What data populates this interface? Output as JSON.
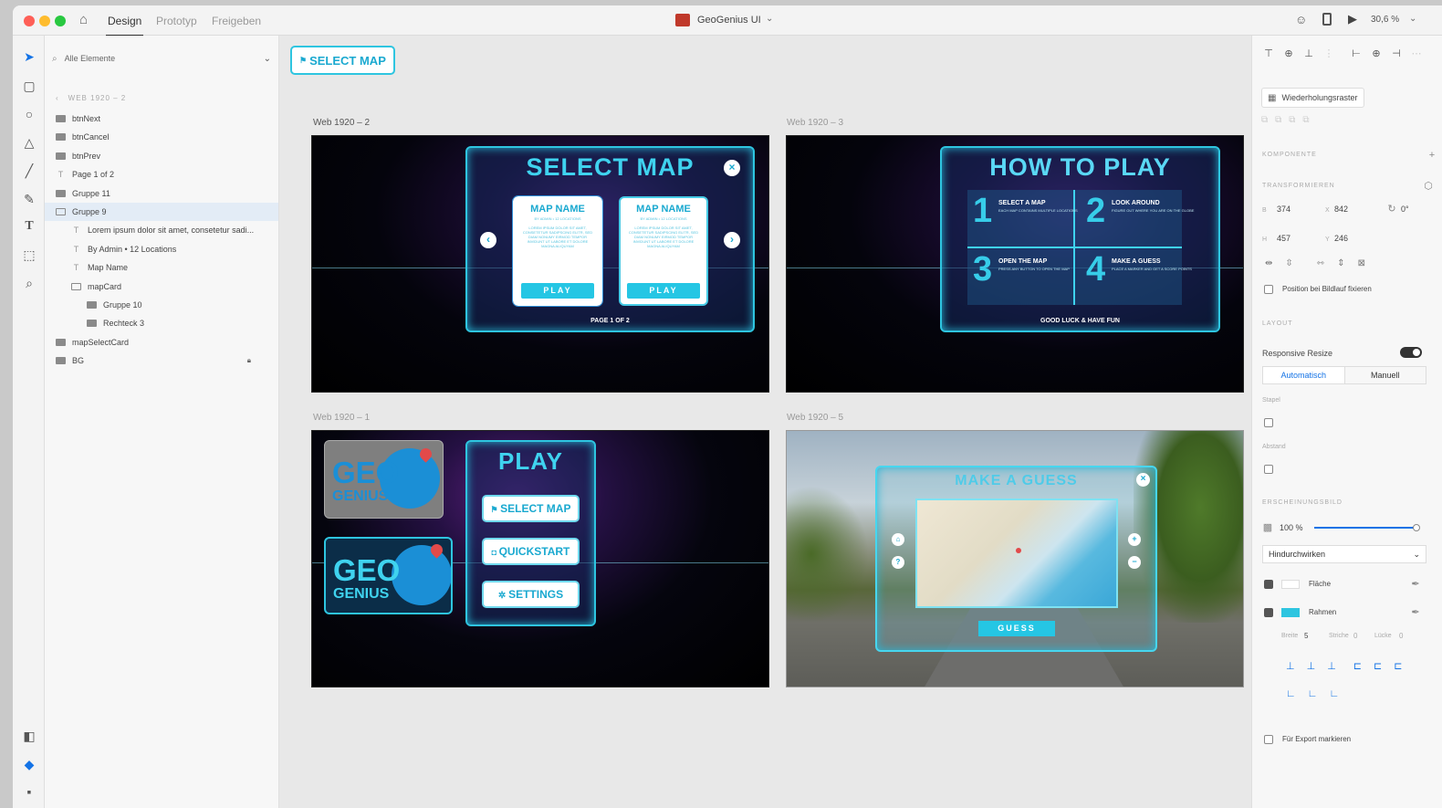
{
  "app": {
    "title": "GeoGenius UI",
    "tabs": [
      "Design",
      "Prototyp",
      "Freigeben"
    ],
    "zoom": "30,6 %"
  },
  "layers": {
    "search_placeholder": "Alle Elemente",
    "breadcrumb": "WEB 1920 – 2",
    "items": [
      {
        "label": "btnNext",
        "indent": 0,
        "kind": "group"
      },
      {
        "label": "btnCancel",
        "indent": 0,
        "kind": "group"
      },
      {
        "label": "btnPrev",
        "indent": 0,
        "kind": "group"
      },
      {
        "label": "Page 1 of 2",
        "indent": 0,
        "kind": "text"
      },
      {
        "label": "Gruppe 11",
        "indent": 0,
        "kind": "group"
      },
      {
        "label": "Gruppe 9",
        "indent": 0,
        "kind": "open",
        "selected": true
      },
      {
        "label": "Lorem ipsum dolor sit amet, consetetur sadi...",
        "indent": 1,
        "kind": "text"
      },
      {
        "label": "By Admin  •  12 Locations",
        "indent": 1,
        "kind": "text"
      },
      {
        "label": "Map Name",
        "indent": 1,
        "kind": "text"
      },
      {
        "label": "mapCard",
        "indent": 1,
        "kind": "open"
      },
      {
        "label": "Gruppe 10",
        "indent": 2,
        "kind": "group"
      },
      {
        "label": "Rechteck 3",
        "indent": 2,
        "kind": "rect"
      },
      {
        "label": "mapSelectCard",
        "indent": 0,
        "kind": "group"
      },
      {
        "label": "BG",
        "indent": 0,
        "kind": "image",
        "locked": true
      }
    ]
  },
  "canvas": {
    "component_badge": "SELECT MAP",
    "artboards": {
      "a2": {
        "label": "Web 1920 – 2",
        "title": "SELECT MAP",
        "card_name": "MAP NAME",
        "card_meta": "BY ADMIN  •  12 LOCATIONS",
        "card_desc": "LOREM IPSUM DOLOR SIT AMET, CONSETETUR SADIPSCING ELITR, SED DIAM NONUMY EIRMOD TEMPOR INVIDUNT UT LABORE ET DOLORE MAGNA ALIQUYAM",
        "play": "PLAY",
        "page": "PAGE 1 OF 2"
      },
      "a3": {
        "label": "Web 1920 – 3",
        "title": "HOW TO PLAY",
        "steps": [
          {
            "num": "1",
            "title": "SELECT A MAP",
            "desc": "EACH MAP CONTAINS MULTIPLE LOCATIONS"
          },
          {
            "num": "2",
            "title": "LOOK AROUND",
            "desc": "FIGURE OUT WHERE YOU ARE ON THE GLOBE"
          },
          {
            "num": "3",
            "title": "OPEN THE MAP",
            "desc": "PRESS ANY BUTTON TO OPEN THE MAP"
          },
          {
            "num": "4",
            "title": "MAKE A GUESS",
            "desc": "PLACE A MARKER AND GET A SCORE POINTS"
          }
        ],
        "footer": "GOOD LUCK & HAVE FUN"
      },
      "a1": {
        "label": "Web 1920 – 1",
        "logo_top": "GEO",
        "logo_bottom": "GENIUS",
        "title": "PLAY",
        "buttons": [
          "SELECT MAP",
          "QUICKSTART",
          "SETTINGS"
        ]
      },
      "a5": {
        "label": "Web 1920 – 5",
        "title": "MAKE A GUESS",
        "button": "GUESS"
      }
    }
  },
  "props": {
    "repeat_grid": "Wiederholungsraster",
    "component": "KOMPONENTE",
    "transform": "TRANSFORMIEREN",
    "w_label": "B",
    "w": "374",
    "x_label": "X",
    "x": "842",
    "h_label": "H",
    "h": "457",
    "y_label": "Y",
    "y": "246",
    "rotation": "0°",
    "fix_position": "Position bei Bildlauf fixieren",
    "layout": "LAYOUT",
    "responsive": "Responsive Resize",
    "auto": "Automatisch",
    "manual": "Manuell",
    "stack": "Stapel",
    "spacing": "Abstand",
    "appearance": "ERSCHEINUNGSBILD",
    "opacity": "100 %",
    "blend": "Hindurchwirken",
    "fill": "Fläche",
    "border": "Rahmen",
    "border_color": "#2ec5e0",
    "stroke_w_label": "Breite",
    "stroke_w": "5",
    "dash_label": "Striche",
    "dash": "0",
    "gap_label": "Lücke",
    "gap": "0",
    "export": "Für Export markieren"
  }
}
